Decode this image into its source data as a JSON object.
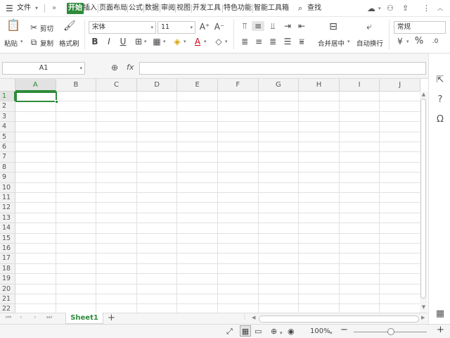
{
  "menubar": {
    "menu_icon": "hamburger-icon",
    "file_label": "文件",
    "more_label": "»",
    "tabs": [
      {
        "label": "开始",
        "active": true
      },
      {
        "label": "插入"
      },
      {
        "label": "页面布局"
      },
      {
        "label": "公式"
      },
      {
        "label": "数据"
      },
      {
        "label": "审阅"
      },
      {
        "label": "视图"
      },
      {
        "label": "开发工具"
      },
      {
        "label": "特色功能"
      },
      {
        "label": "智能工具箱"
      }
    ],
    "search_label": "查找",
    "accent_color": "#2e8b3a"
  },
  "ribbon": {
    "paste_label": "粘贴",
    "cut_label": "剪切",
    "copy_label": "复制",
    "format_painter_label": "格式刷",
    "font_name": "宋体",
    "font_size": "11",
    "bold": "B",
    "italic": "I",
    "underline": "U",
    "font_color_glyph": "A",
    "merge_center_label": "合并居中",
    "auto_wrap_label": "自动换行",
    "number_format": "常规",
    "percent": "%"
  },
  "formula_bar": {
    "name_box": "A1",
    "fx_label": "fx",
    "formula_value": ""
  },
  "grid": {
    "columns": [
      "A",
      "B",
      "C",
      "D",
      "E",
      "F",
      "G",
      "H",
      "I",
      "J"
    ],
    "rows": [
      "1",
      "2",
      "3",
      "4",
      "5",
      "6",
      "7",
      "8",
      "9",
      "10",
      "11",
      "12",
      "13",
      "14",
      "15",
      "16",
      "17",
      "18",
      "19",
      "20",
      "21",
      "22"
    ],
    "selected_column": "A",
    "selected_row": "1"
  },
  "sheets": {
    "tabs": [
      {
        "label": "Sheet1",
        "active": true
      }
    ],
    "add_label": "+"
  },
  "statusbar": {
    "zoom": "100%",
    "zoom_out": "−",
    "zoom_in": "+"
  }
}
